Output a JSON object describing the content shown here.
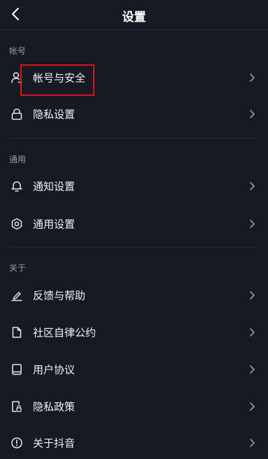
{
  "header": {
    "title": "设置"
  },
  "sections": [
    {
      "label": "帐号",
      "items": [
        {
          "label": "帐号与安全",
          "icon": "user-icon"
        },
        {
          "label": "隐私设置",
          "icon": "lock-icon"
        }
      ]
    },
    {
      "label": "通用",
      "items": [
        {
          "label": "通知设置",
          "icon": "bell-icon"
        },
        {
          "label": "通用设置",
          "icon": "gear-icon"
        }
      ]
    },
    {
      "label": "关于",
      "items": [
        {
          "label": "反馈与帮助",
          "icon": "edit-icon"
        },
        {
          "label": "社区自律公约",
          "icon": "document-icon"
        },
        {
          "label": "用户协议",
          "icon": "book-icon"
        },
        {
          "label": "隐私政策",
          "icon": "privacy-lock-icon"
        },
        {
          "label": "关于抖音",
          "icon": "info-icon"
        }
      ]
    }
  ],
  "colors": {
    "background": "#161823",
    "text": "#f2f2f4",
    "section_label": "#9a9ba1",
    "highlight": "#d9141a"
  }
}
